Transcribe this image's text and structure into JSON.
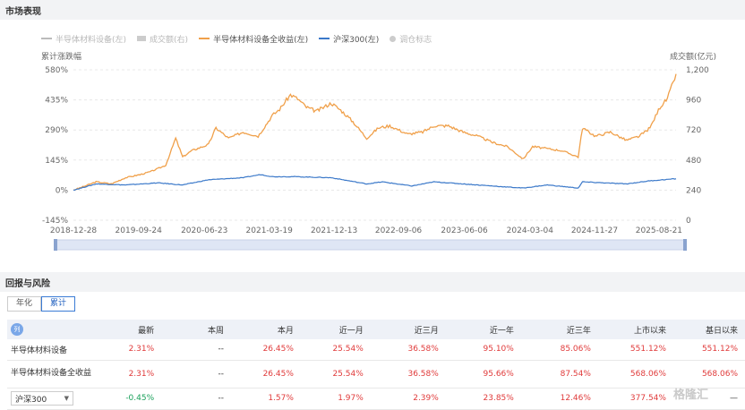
{
  "sections": {
    "market": "市场表现",
    "returns": "回报与风险"
  },
  "legend": [
    {
      "label": "半导体材料设备(左)",
      "color": "#bbbbbb",
      "style": "line",
      "dim": true
    },
    {
      "label": "成交额(右)",
      "color": "#cccccc",
      "style": "bar",
      "dim": true
    },
    {
      "label": "半导体材料设备全收益(左)",
      "color": "#f0a04a",
      "style": "line",
      "dim": false
    },
    {
      "label": "沪深300(左)",
      "color": "#3a78c9",
      "style": "line",
      "dim": false
    },
    {
      "label": "调仓标志",
      "color": "#cccccc",
      "style": "dot",
      "dim": true
    }
  ],
  "chart_data": {
    "type": "line",
    "ylabel": "累计涨跌幅",
    "y2label": "成交额(亿元)",
    "y_ticks": [
      "580%",
      "435%",
      "290%",
      "145%",
      "0%",
      "-145%"
    ],
    "y_range": [
      -145,
      580
    ],
    "y2_ticks": [
      "1,200",
      "960",
      "720",
      "480",
      "240",
      "0"
    ],
    "y2_range": [
      0,
      1200
    ],
    "x_ticks": [
      "2018-12-28",
      "2019-09-24",
      "2020-06-23",
      "2021-03-19",
      "2021-12-13",
      "2022-09-06",
      "2023-06-06",
      "2024-03-04",
      "2024-11-27",
      "2025-08-21"
    ],
    "x_range": [
      "2018-12-28",
      "2025-10-31"
    ],
    "series": [
      {
        "name": "半导体材料设备全收益(左)",
        "color": "#f0a04a",
        "points": [
          [
            "2018-12-28",
            0
          ],
          [
            "2019-02-15",
            20
          ],
          [
            "2019-04-01",
            40
          ],
          [
            "2019-06-03",
            30
          ],
          [
            "2019-08-01",
            60
          ],
          [
            "2019-10-01",
            75
          ],
          [
            "2019-11-15",
            90
          ],
          [
            "2020-01-15",
            120
          ],
          [
            "2020-02-25",
            250
          ],
          [
            "2020-03-25",
            160
          ],
          [
            "2020-05-01",
            190
          ],
          [
            "2020-07-10",
            220
          ],
          [
            "2020-08-10",
            300
          ],
          [
            "2020-10-01",
            250
          ],
          [
            "2020-12-01",
            280
          ],
          [
            "2021-02-01",
            260
          ],
          [
            "2021-04-01",
            360
          ],
          [
            "2021-05-01",
            390
          ],
          [
            "2021-06-15",
            460
          ],
          [
            "2021-07-15",
            440
          ],
          [
            "2021-08-20",
            400
          ],
          [
            "2021-10-01",
            380
          ],
          [
            "2021-12-01",
            420
          ],
          [
            "2022-01-15",
            380
          ],
          [
            "2022-03-01",
            330
          ],
          [
            "2022-04-27",
            250
          ],
          [
            "2022-06-15",
            300
          ],
          [
            "2022-08-01",
            310
          ],
          [
            "2022-10-15",
            270
          ],
          [
            "2022-12-15",
            280
          ],
          [
            "2023-02-01",
            310
          ],
          [
            "2023-04-01",
            310
          ],
          [
            "2023-06-01",
            280
          ],
          [
            "2023-08-01",
            260
          ],
          [
            "2023-10-01",
            230
          ],
          [
            "2023-12-01",
            210
          ],
          [
            "2024-02-05",
            150
          ],
          [
            "2024-03-15",
            210
          ],
          [
            "2024-05-15",
            200
          ],
          [
            "2024-07-15",
            190
          ],
          [
            "2024-09-20",
            160
          ],
          [
            "2024-10-08",
            300
          ],
          [
            "2024-12-01",
            260
          ],
          [
            "2025-02-01",
            280
          ],
          [
            "2025-04-08",
            240
          ],
          [
            "2025-06-01",
            260
          ],
          [
            "2025-07-15",
            300
          ],
          [
            "2025-08-25",
            400
          ],
          [
            "2025-09-25",
            440
          ],
          [
            "2025-10-31",
            560
          ]
        ]
      },
      {
        "name": "沪深300(左)",
        "color": "#3a78c9",
        "points": [
          [
            "2018-12-28",
            0
          ],
          [
            "2019-04-01",
            30
          ],
          [
            "2019-08-01",
            25
          ],
          [
            "2019-12-15",
            35
          ],
          [
            "2020-03-25",
            25
          ],
          [
            "2020-07-10",
            50
          ],
          [
            "2020-12-01",
            60
          ],
          [
            "2021-02-10",
            75
          ],
          [
            "2021-04-01",
            65
          ],
          [
            "2021-07-01",
            65
          ],
          [
            "2021-12-01",
            60
          ],
          [
            "2022-04-27",
            30
          ],
          [
            "2022-07-01",
            40
          ],
          [
            "2022-10-31",
            20
          ],
          [
            "2023-01-31",
            40
          ],
          [
            "2023-06-01",
            30
          ],
          [
            "2023-12-01",
            15
          ],
          [
            "2024-02-05",
            10
          ],
          [
            "2024-05-15",
            25
          ],
          [
            "2024-09-20",
            10
          ],
          [
            "2024-10-08",
            40
          ],
          [
            "2025-04-08",
            30
          ],
          [
            "2025-07-15",
            45
          ],
          [
            "2025-10-31",
            55
          ]
        ]
      }
    ]
  },
  "tabs": [
    {
      "label": "年化",
      "active": false
    },
    {
      "label": "累计",
      "active": true
    }
  ],
  "table": {
    "corner_icon": "列",
    "headers": [
      "最新",
      "本周",
      "本月",
      "近一月",
      "近三月",
      "近一年",
      "近三年",
      "上市以来",
      "基日以来"
    ],
    "rows": [
      {
        "name": "半导体材料设备",
        "values": [
          "2.31%",
          "--",
          "26.45%",
          "25.54%",
          "36.58%",
          "95.10%",
          "85.06%",
          "551.12%",
          "551.12%"
        ],
        "tones": [
          "red",
          "neutral",
          "red",
          "red",
          "red",
          "red",
          "red",
          "red",
          "red"
        ]
      },
      {
        "name": "半导体材料设备全收益",
        "values": [
          "2.31%",
          "--",
          "26.45%",
          "25.54%",
          "36.58%",
          "95.66%",
          "87.54%",
          "568.06%",
          "568.06%"
        ],
        "tones": [
          "red",
          "neutral",
          "red",
          "red",
          "red",
          "red",
          "red",
          "red",
          "red"
        ]
      },
      {
        "name": "沪深300",
        "select": true,
        "values": [
          "-0.45%",
          "--",
          "1.57%",
          "1.97%",
          "2.39%",
          "23.85%",
          "12.46%",
          "377.54%",
          "—"
        ],
        "tones": [
          "green",
          "neutral",
          "red",
          "red",
          "red",
          "red",
          "red",
          "red",
          "neutral"
        ]
      }
    ]
  },
  "watermark": "格隆汇"
}
